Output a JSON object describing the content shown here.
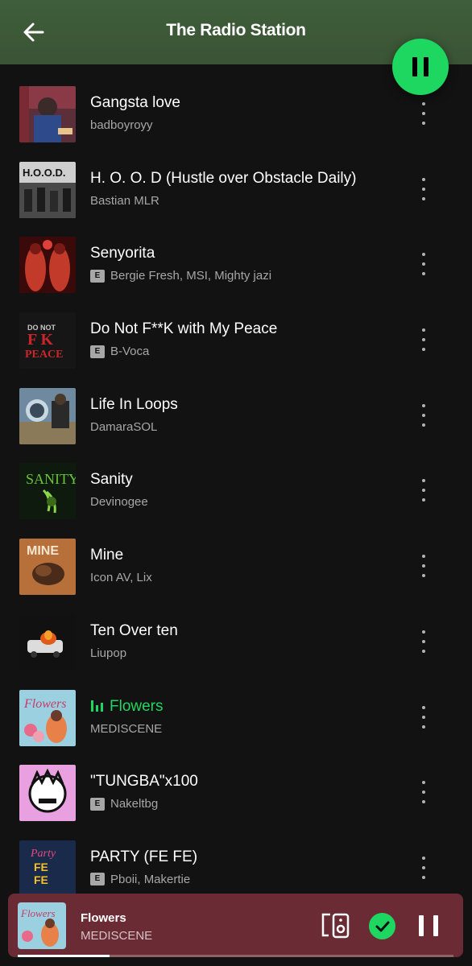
{
  "header": {
    "title": "The Radio Station",
    "back_icon": "arrow-left-icon"
  },
  "fab": {
    "icon": "pause-icon",
    "color": "#1ed760"
  },
  "tracks": [
    {
      "title": "Gangsta love",
      "artist": "badboyroyy",
      "explicit": false,
      "playing": false
    },
    {
      "title": "H. O. O. D (Hustle over Obstacle Daily)",
      "artist": "Bastian MLR",
      "explicit": false,
      "playing": false
    },
    {
      "title": "Senyorita",
      "artist": "Bergie Fresh, MSI, Mighty jazi",
      "explicit": true,
      "playing": false
    },
    {
      "title": "Do Not F**K with My Peace",
      "artist": "B-Voca",
      "explicit": true,
      "playing": false
    },
    {
      "title": "Life In Loops",
      "artist": "DamaraSOL",
      "explicit": false,
      "playing": false
    },
    {
      "title": "Sanity",
      "artist": "Devinogee",
      "explicit": false,
      "playing": false
    },
    {
      "title": "Mine",
      "artist": "Icon AV, Lix",
      "explicit": false,
      "playing": false
    },
    {
      "title": "Ten Over ten",
      "artist": "Liupop",
      "explicit": false,
      "playing": false
    },
    {
      "title": "Flowers",
      "artist": "MEDISCENE",
      "explicit": false,
      "playing": true
    },
    {
      "title": "\"TUNGBA\"x100",
      "artist": "Nakeltbg",
      "explicit": true,
      "playing": false
    },
    {
      "title": "PARTY (FE FE)",
      "artist": "Pboii, Makertie",
      "explicit": true,
      "playing": false
    }
  ],
  "explicit_label": "E",
  "mini_player": {
    "title": "Flowers",
    "artist": "MEDISCENE",
    "progress": 0.21,
    "background": "#6b2b35",
    "icons": [
      "connect-device-icon",
      "saved-check-icon",
      "pause-icon"
    ]
  },
  "colors": {
    "accent": "#1ed760",
    "header": "#3f5e3a",
    "subtext": "#a7a7a7"
  }
}
